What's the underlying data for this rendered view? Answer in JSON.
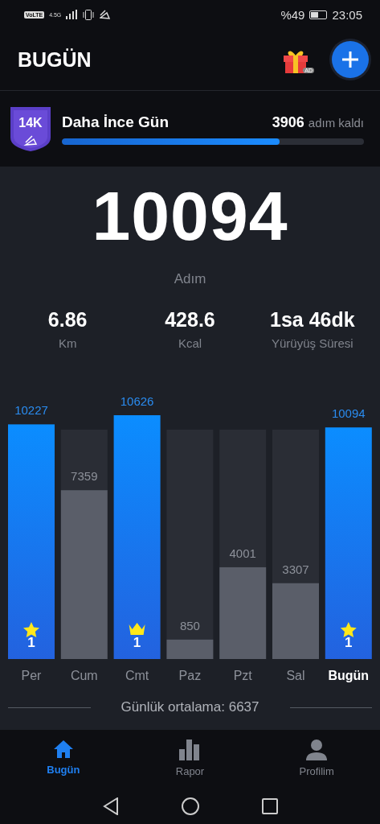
{
  "status_bar": {
    "network": "VoLTE",
    "generation": "4.5G",
    "battery": "%49",
    "time": "23:05"
  },
  "header": {
    "title": "BUGÜN",
    "gift_badge": "AD"
  },
  "goal": {
    "badge": "14K",
    "title": "Daha İnce Gün",
    "remaining": "3906",
    "remaining_label": "adım kaldı",
    "level": 0.72
  },
  "steps": {
    "value": "10094",
    "label": "Adım"
  },
  "stats": [
    {
      "value": "6.86",
      "label": "Km"
    },
    {
      "value": "428.6",
      "label": "Kcal"
    },
    {
      "value": "1sa 46dk",
      "label": "Yürüyüş Süresi"
    }
  ],
  "week": {
    "chart_data": {
      "type": "bar",
      "categories": [
        "Per",
        "Cum",
        "Cmt",
        "Paz",
        "Pzt",
        "Sal",
        "Bugün"
      ],
      "values": [
        10227,
        7359,
        10626,
        850,
        4001,
        3307,
        10094
      ],
      "ylim": [
        0,
        10626
      ],
      "data_labels": true
    },
    "days": [
      {
        "goal_met": true,
        "selected": false,
        "badge": {
          "kind": "star",
          "count": "1"
        }
      },
      {
        "goal_met": false,
        "selected": false
      },
      {
        "goal_met": true,
        "selected": false,
        "badge": {
          "kind": "crown",
          "count": "1"
        }
      },
      {
        "goal_met": false,
        "selected": false
      },
      {
        "goal_met": false,
        "selected": false
      },
      {
        "goal_met": false,
        "selected": false
      },
      {
        "goal_met": true,
        "selected": true,
        "badge": {
          "kind": "star",
          "count": "1"
        }
      }
    ]
  },
  "average": "Günlük ortalama: 6637",
  "nav": [
    {
      "label": "Bugün",
      "kind": "home",
      "selected": true
    },
    {
      "label": "Rapor",
      "kind": "report",
      "selected": false
    },
    {
      "label": "Profilim",
      "kind": "profile",
      "selected": false
    }
  ]
}
